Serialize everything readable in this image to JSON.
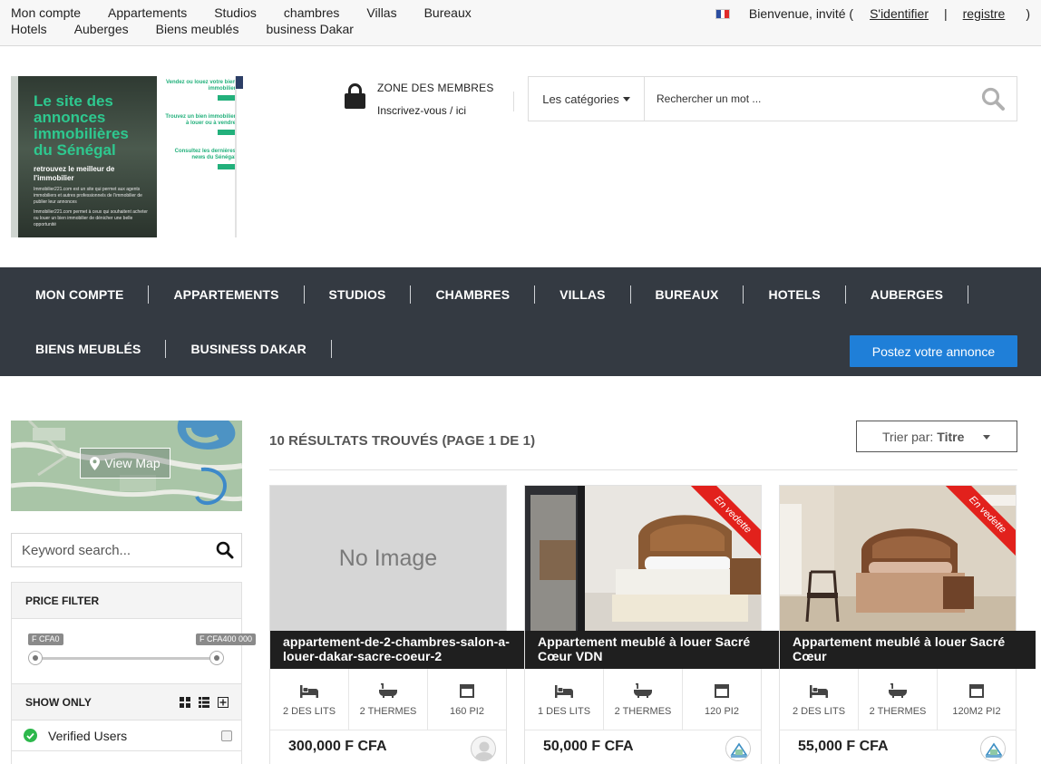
{
  "topbar": {
    "nav": [
      "Mon compte",
      "Appartements",
      "Studios",
      "chambres",
      "Villas",
      "Bureaux",
      "Hotels",
      "Auberges",
      "Biens meublés",
      "business Dakar"
    ],
    "welcome": "Bienvenue, invité (",
    "login": "S'identifier",
    "separator": "|",
    "register": "registre",
    "close_paren": ")"
  },
  "banner": {
    "title": "Le site des annonces immobilières du Sénégal",
    "subtitle": "retrouvez le meilleur de l'immobilier",
    "text1": "Immobilier221.com est un site qui permet aux agents immobiliers et autres professionnels de l'immobilier de publier leur annonces",
    "text2": "Immobilier221.com permet à ceux qui souhaitent acheter ou louer un bien immobilier de dénicher une belle opportunité",
    "right_items": [
      "Vendez ou louez votre bien immobilier",
      "Trouvez un bien immobilier à louer ou à vendre",
      "Consultez les dernières news du Sénégal"
    ]
  },
  "members": {
    "title": "ZONE DES MEMBRES",
    "subtitle": "Inscrivez-vous / ici"
  },
  "search": {
    "categories_label": "Les catégories",
    "placeholder": "Rechercher un mot ..."
  },
  "mainnav": {
    "row1": [
      "MON COMPTE",
      "APPARTEMENTS",
      "STUDIOS",
      "CHAMBRES",
      "VILLAS",
      "BUREAUX",
      "HOTELS",
      "AUBERGES"
    ],
    "row2": [
      "BIENS MEUBLÉS",
      "BUSINESS DAKAR"
    ],
    "post_button": "Postez votre annonce"
  },
  "sidebar": {
    "view_map": "View Map",
    "keyword_placeholder": "Keyword search...",
    "price_filter": {
      "title": "PRICE FILTER",
      "min_label": "F CFA0",
      "max_label": "F CFA400 000"
    },
    "show_only": {
      "title": "SHOW ONLY",
      "filters": [
        {
          "label": "Verified Users",
          "checked": false
        }
      ]
    }
  },
  "results": {
    "title": "10 RÉSULTATS TROUVÉS (PAGE 1 DE 1)",
    "sort_label": "Trier par:",
    "sort_value": "Titre",
    "listings": [
      {
        "title": "appartement-de-2-chambres-salon-a-louer-dakar-sacre-coeur-2",
        "image": "No Image",
        "featured": false,
        "beds": "2 DES LITS",
        "baths": "2 THERMES",
        "area": "160 PI2",
        "price": "300,000 F CFA"
      },
      {
        "title": "Appartement meublé à louer Sacré Cœur VDN",
        "image": "",
        "featured": true,
        "ribbon": "En vedette",
        "beds": "1 DES LITS",
        "baths": "2 THERMES",
        "area": "120 PI2",
        "price": "50,000 F CFA"
      },
      {
        "title": "Appartement meublé à louer Sacré Cœur",
        "image": "",
        "featured": true,
        "ribbon": "En vedette",
        "beds": "2 DES LITS",
        "baths": "2 THERMES",
        "area": "120M2 PI2",
        "price": "55,000 F CFA"
      }
    ]
  },
  "colors": {
    "nav_bg": "#343a42",
    "accent_blue": "#1f7fd8",
    "ribbon_red": "#e2211c",
    "verified_green": "#2db84c",
    "banner_green": "#2ec88f"
  }
}
